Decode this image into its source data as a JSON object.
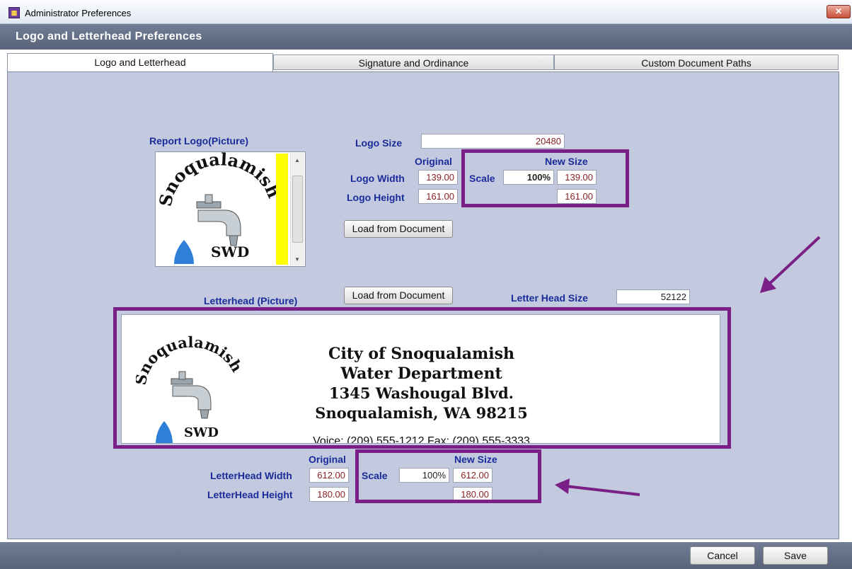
{
  "window": {
    "title": "Administrator Preferences",
    "close_label": "✕"
  },
  "header": {
    "title": "Logo and Letterhead Preferences"
  },
  "tabs": [
    {
      "label": "Logo and Letterhead",
      "active": true
    },
    {
      "label": "Signature and Ordinance",
      "active": false
    },
    {
      "label": "Custom Document Paths",
      "active": false
    }
  ],
  "logo": {
    "section_label": "Report Logo(Picture)",
    "size_label": "Logo Size",
    "size_value": "20480",
    "original_header": "Original",
    "new_size_header": "New Size",
    "width_label": "Logo Width",
    "height_label": "Logo Height",
    "width_original": "139.00",
    "height_original": "161.00",
    "scale_label": "Scale",
    "scale_value": "100%",
    "width_new": "139.00",
    "height_new": "161.00",
    "load_button": "Load from Document",
    "image": {
      "arc_text": "Snoqualamish",
      "caption": "SWD"
    }
  },
  "letterhead": {
    "section_label": "Letterhead (Picture)",
    "load_button": "Load from Document",
    "size_label": "Letter Head Size",
    "size_value": "52122",
    "original_header": "Original",
    "new_size_header": "New Size",
    "width_label": "LetterHead Width",
    "height_label": "LetterHead Height",
    "width_original": "612.00",
    "height_original": "180.00",
    "scale_label": "Scale",
    "scale_value": "100%",
    "width_new": "612.00",
    "height_new": "180.00",
    "image": {
      "arc_text": "Snoqualamish",
      "caption": "SWD",
      "line1": "City of Snoqualamish",
      "line2": "Water Department",
      "line3": "1345 Washougal Blvd.",
      "line4": "Snoqualamish, WA  98215",
      "line5": "Voice: (209) 555-1212     Fax: (209) 555-3333"
    }
  },
  "footer": {
    "cancel_label": "Cancel",
    "save_label": "Save"
  },
  "colors": {
    "highlight": "#7a1f86",
    "label": "#1a2b9a",
    "panel": "#c3cadf"
  }
}
